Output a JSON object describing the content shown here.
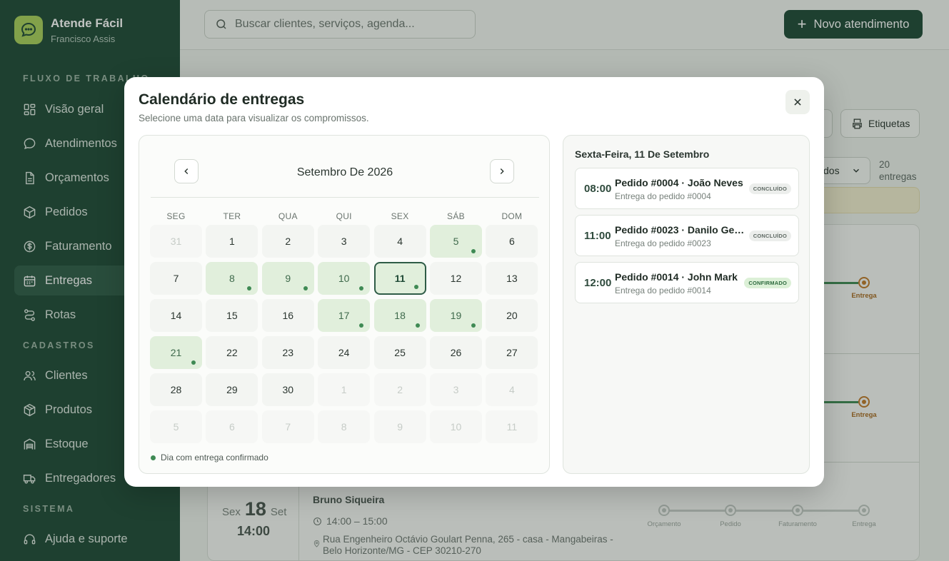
{
  "brand": {
    "title": "Atende Fácil",
    "subtitle": "Francisco Assis",
    "icon": "chat-bubble-icon"
  },
  "sidebar": {
    "sections": {
      "workflow": "FLUXO DE TRABALHO",
      "registry": "CADASTROS",
      "system": "SISTEMA"
    },
    "items": [
      {
        "label": "Visão geral",
        "icon": "dashboard-icon"
      },
      {
        "label": "Atendimentos",
        "icon": "chat-icon"
      },
      {
        "label": "Orçamentos",
        "icon": "document-icon"
      },
      {
        "label": "Pedidos",
        "icon": "box-icon"
      },
      {
        "label": "Faturamento",
        "icon": "dollar-icon"
      },
      {
        "label": "Entregas",
        "icon": "calendar-icon",
        "active": true
      },
      {
        "label": "Rotas",
        "icon": "route-icon"
      },
      {
        "label": "Clientes",
        "icon": "users-icon"
      },
      {
        "label": "Produtos",
        "icon": "package-icon"
      },
      {
        "label": "Estoque",
        "icon": "warehouse-icon"
      },
      {
        "label": "Entregadores",
        "icon": "truck-icon"
      },
      {
        "label": "Ajuda e suporte",
        "icon": "headset-icon"
      }
    ]
  },
  "topbar": {
    "search_placeholder": "Buscar clientes, serviços, agenda...",
    "new_button": "Novo atendimento"
  },
  "background": {
    "labels_button": "Etiquetas",
    "select_value": "dos",
    "count_number": "20",
    "count_word": "entregas",
    "tracking_labels": [
      "Orçamento",
      "Pedido",
      "Faturamento",
      "Entrega"
    ],
    "row": {
      "weekday": "Sex",
      "day": "18",
      "month": "Set",
      "time": "14:00",
      "client": "Bruno Siqueira",
      "hours": "14:00 – 15:00",
      "address_line1": "Rua Engenheiro Octávio Goulart Penna, 265 - casa - Mangabeiras -",
      "address_line2": "Belo Horizonte/MG - CEP 30210-270"
    }
  },
  "modal": {
    "title": "Calendário de entregas",
    "subtitle": "Selecione uma data para visualizar os compromissos.",
    "month_label": "Setembro De 2026",
    "weekdays": [
      "SEG",
      "TER",
      "QUA",
      "QUI",
      "SEX",
      "SÁB",
      "DOM"
    ],
    "days": [
      {
        "n": "31",
        "muted": true
      },
      {
        "n": "1"
      },
      {
        "n": "2"
      },
      {
        "n": "3"
      },
      {
        "n": "4"
      },
      {
        "n": "5",
        "has": true
      },
      {
        "n": "6"
      },
      {
        "n": "7"
      },
      {
        "n": "8",
        "has": true
      },
      {
        "n": "9",
        "has": true
      },
      {
        "n": "10",
        "has": true
      },
      {
        "n": "11",
        "has": true,
        "selected": true
      },
      {
        "n": "12"
      },
      {
        "n": "13"
      },
      {
        "n": "14"
      },
      {
        "n": "15"
      },
      {
        "n": "16"
      },
      {
        "n": "17",
        "has": true
      },
      {
        "n": "18",
        "has": true
      },
      {
        "n": "19",
        "has": true
      },
      {
        "n": "20"
      },
      {
        "n": "21",
        "has": true
      },
      {
        "n": "22"
      },
      {
        "n": "23"
      },
      {
        "n": "24"
      },
      {
        "n": "25"
      },
      {
        "n": "26"
      },
      {
        "n": "27"
      },
      {
        "n": "28"
      },
      {
        "n": "29"
      },
      {
        "n": "30"
      },
      {
        "n": "1",
        "muted": true
      },
      {
        "n": "2",
        "muted": true
      },
      {
        "n": "3",
        "muted": true
      },
      {
        "n": "4",
        "muted": true
      },
      {
        "n": "5",
        "muted": true
      },
      {
        "n": "6",
        "muted": true
      },
      {
        "n": "7",
        "muted": true
      },
      {
        "n": "8",
        "muted": true
      },
      {
        "n": "9",
        "muted": true
      },
      {
        "n": "10",
        "muted": true
      },
      {
        "n": "11",
        "muted": true
      }
    ],
    "legend": "Dia com entrega confirmado",
    "selected_date_label": "Sexta-Feira, 11 De Setembro",
    "appointments": [
      {
        "time": "08:00",
        "title": "Pedido #0004 · João Neves",
        "subtitle": "Entrega do pedido #0004",
        "status": "CONCLUÍDO",
        "status_type": "gray"
      },
      {
        "time": "11:00",
        "title": "Pedido #0023 · Danilo Gen...",
        "subtitle": "Entrega do pedido #0023",
        "status": "CONCLUÍDO",
        "status_type": "gray"
      },
      {
        "time": "12:00",
        "title": "Pedido #0014 · John Mark",
        "subtitle": "Entrega do pedido #0014",
        "status": "CONFIRMADO",
        "status_type": "green"
      }
    ]
  },
  "colors": {
    "sidebar_bg": "#1f4a36",
    "accent_green": "#3f8a54",
    "brand_lime": "#a9d05a",
    "delivery_orange": "#c07a2a"
  }
}
